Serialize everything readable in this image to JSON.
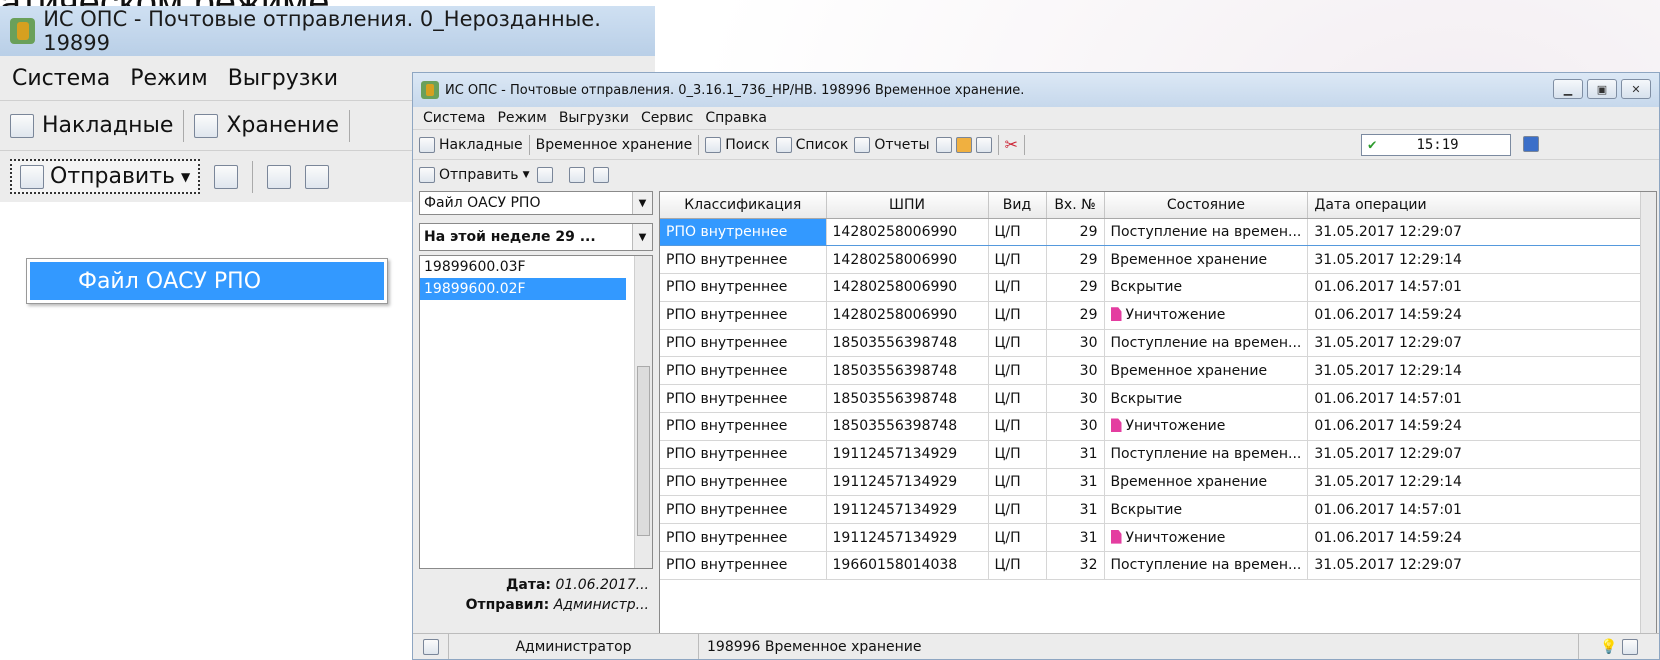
{
  "slide_title": "атическом режиме.",
  "back": {
    "title": "ИС ОПС - Почтовые отправления. 0_Нерозданные. 19899",
    "menu": [
      "Система",
      "Режим",
      "Выгрузки"
    ],
    "toolbar": {
      "invoices": "Накладные",
      "storage": "Хранение"
    },
    "send": "Отправить",
    "dropdown_item": "Файл ОАСУ РПО"
  },
  "front": {
    "title": "ИС ОПС - Почтовые отправления. 0_3.16.1_736_НР/НВ. 198996 Временное хранение.",
    "menu": [
      "Система",
      "Режим",
      "Выгрузки",
      "Сервис",
      "Справка"
    ],
    "toolbar": {
      "invoices": "Накладные",
      "temp_storage": "Временное хранение",
      "search": "Поиск",
      "list": "Список",
      "reports": "Отчеты"
    },
    "clock": "15:19",
    "send": "Отправить",
    "left": {
      "file_type": "Файл ОАСУ РПО",
      "period": "На этой неделе 29 ...",
      "files": [
        "19899600.03F",
        "19899600.02F"
      ],
      "date_label": "Дата:",
      "date_value": "01.06.2017...",
      "sender_label": "Отправил:",
      "sender_value": "Администр..."
    },
    "grid": {
      "columns": [
        "Классификация",
        "ШПИ",
        "Вид",
        "Вх. №",
        "Состояние",
        "Дата операции"
      ],
      "rows": [
        [
          "РПО внутреннее",
          "14280258006990",
          "Ц/П",
          "29",
          "Поступление на времен...",
          "31.05.2017 12:29:07"
        ],
        [
          "РПО внутреннее",
          "14280258006990",
          "Ц/П",
          "29",
          "Временное хранение",
          "31.05.2017 12:29:14"
        ],
        [
          "РПО внутреннее",
          "14280258006990",
          "Ц/П",
          "29",
          "Вскрытие",
          "01.06.2017 14:57:01"
        ],
        [
          "РПО внутреннее",
          "14280258006990",
          "Ц/П",
          "29",
          "Уничтожение",
          "01.06.2017 14:59:24"
        ],
        [
          "РПО внутреннее",
          "18503556398748",
          "Ц/П",
          "30",
          "Поступление на времен...",
          "31.05.2017 12:29:07"
        ],
        [
          "РПО внутреннее",
          "18503556398748",
          "Ц/П",
          "30",
          "Временное хранение",
          "31.05.2017 12:29:14"
        ],
        [
          "РПО внутреннее",
          "18503556398748",
          "Ц/П",
          "30",
          "Вскрытие",
          "01.06.2017 14:57:01"
        ],
        [
          "РПО внутреннее",
          "18503556398748",
          "Ц/П",
          "30",
          "Уничтожение",
          "01.06.2017 14:59:24"
        ],
        [
          "РПО внутреннее",
          "19112457134929",
          "Ц/П",
          "31",
          "Поступление на времен...",
          "31.05.2017 12:29:07"
        ],
        [
          "РПО внутреннее",
          "19112457134929",
          "Ц/П",
          "31",
          "Временное хранение",
          "31.05.2017 12:29:14"
        ],
        [
          "РПО внутреннее",
          "19112457134929",
          "Ц/П",
          "31",
          "Вскрытие",
          "01.06.2017 14:57:01"
        ],
        [
          "РПО внутреннее",
          "19112457134929",
          "Ц/П",
          "31",
          "Уничтожение",
          "01.06.2017 14:59:24"
        ],
        [
          "РПО внутреннее",
          "19660158014038",
          "Ц/П",
          "32",
          "Поступление на времен...",
          "31.05.2017 12:29:07"
        ]
      ]
    },
    "status": {
      "user": "Администратор",
      "mode": "198996 Временное хранение"
    }
  }
}
